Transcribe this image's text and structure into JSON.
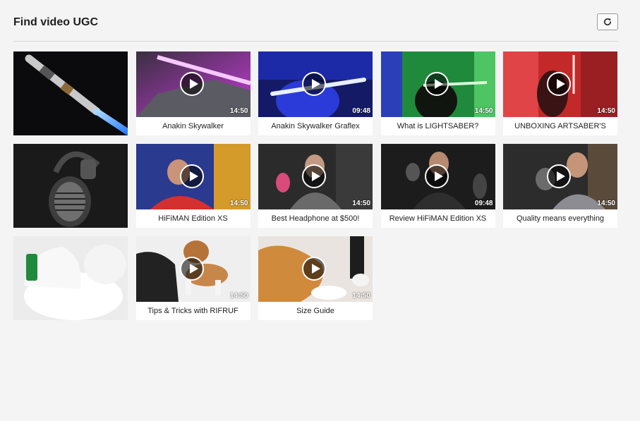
{
  "header": {
    "title": "Find video UGC"
  },
  "colors": {
    "background": "#f4f4f4",
    "card": "#ffffff",
    "divider": "#d6d6d6"
  },
  "refresh_icon": "refresh-icon",
  "play_icon": "play-icon",
  "cards": [
    {
      "caption": "",
      "duration": ""
    },
    {
      "caption": "Anakin Skywalker",
      "duration": "14:50"
    },
    {
      "caption": "Anakin Skywalker Graflex",
      "duration": "09:48"
    },
    {
      "caption": "What is LIGHTSABER?",
      "duration": "14:50"
    },
    {
      "caption": "UNBOXING ARTSABER'S",
      "duration": "14:50"
    },
    {
      "caption": "",
      "duration": ""
    },
    {
      "caption": "HiFiMAN Edition XS",
      "duration": "14:50"
    },
    {
      "caption": "Best Headphone at $500!",
      "duration": "14:50"
    },
    {
      "caption": "Review HiFiMAN Edition XS",
      "duration": "09:48"
    },
    {
      "caption": "Quality means everything",
      "duration": "14:50"
    },
    {
      "caption": "",
      "duration": ""
    },
    {
      "caption": "Tips & Tricks with RIFRUF",
      "duration": "14:50"
    },
    {
      "caption": "Size Guide",
      "duration": "14:50"
    }
  ]
}
